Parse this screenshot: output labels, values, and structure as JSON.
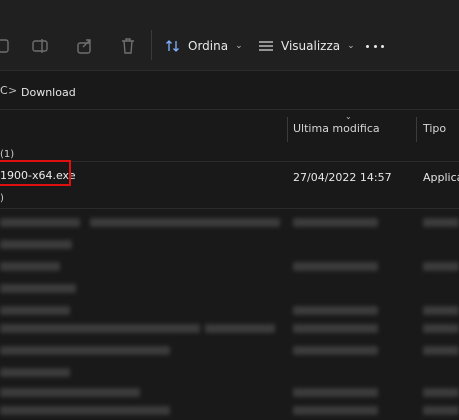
{
  "toolbar": {
    "icons": [
      "copy-icon",
      "rename-icon",
      "share-icon",
      "delete-icon"
    ],
    "sort": {
      "icon": "sort-icon",
      "label": "Ordina"
    },
    "view": {
      "icon": "view-icon",
      "label": "Visualizza"
    },
    "more_icon": "more-icon"
  },
  "address": {
    "prev_fragment": "C",
    "separator": ">",
    "current": "Download"
  },
  "columns": {
    "modified": "Ultima modifica",
    "type": "Tipo"
  },
  "groups": {
    "first": "(1)",
    "second": ")"
  },
  "file": {
    "name": "1900-x64.exe",
    "modified": "27/04/2022 14:57",
    "type": "Applica"
  },
  "colors": {
    "background": "#191919",
    "toolbar": "#202020",
    "highlight": "#e01010"
  }
}
